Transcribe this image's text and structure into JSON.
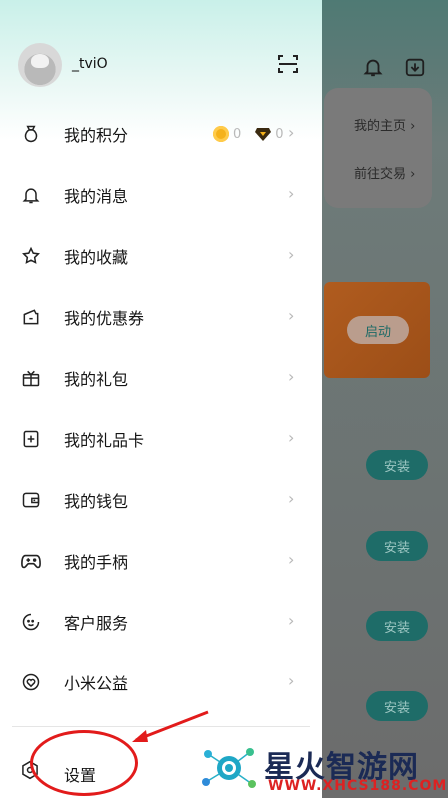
{
  "background": {
    "links": [
      "我的主页 ›",
      "前往交易 ›"
    ],
    "launch_label": "启动",
    "install_label": "安装"
  },
  "profile": {
    "username": "_tviO"
  },
  "points": {
    "coin_count": "0",
    "diamond_count": "0"
  },
  "menu": [
    {
      "label": "我的积分",
      "icon": "points-bag-icon"
    },
    {
      "label": "我的消息",
      "icon": "bell-icon"
    },
    {
      "label": "我的收藏",
      "icon": "star-icon"
    },
    {
      "label": "我的优惠券",
      "icon": "coupon-icon"
    },
    {
      "label": "我的礼包",
      "icon": "gift-box-icon"
    },
    {
      "label": "我的礼品卡",
      "icon": "gift-card-icon"
    },
    {
      "label": "我的钱包",
      "icon": "wallet-icon"
    },
    {
      "label": "我的手柄",
      "icon": "gamepad-icon"
    },
    {
      "label": "客户服务",
      "icon": "customer-service-icon"
    },
    {
      "label": "小米公益",
      "icon": "charity-heart-icon"
    }
  ],
  "settings": {
    "label": "设置",
    "icon": "settings-hexagon-icon"
  },
  "watermark": {
    "title": "星火智游网",
    "url": "WWW.XHCS188.COM"
  },
  "colors": {
    "accent_teal": "#1e6c68",
    "annotation_red": "#e21b1b",
    "coin_gold": "#f5b21b"
  }
}
